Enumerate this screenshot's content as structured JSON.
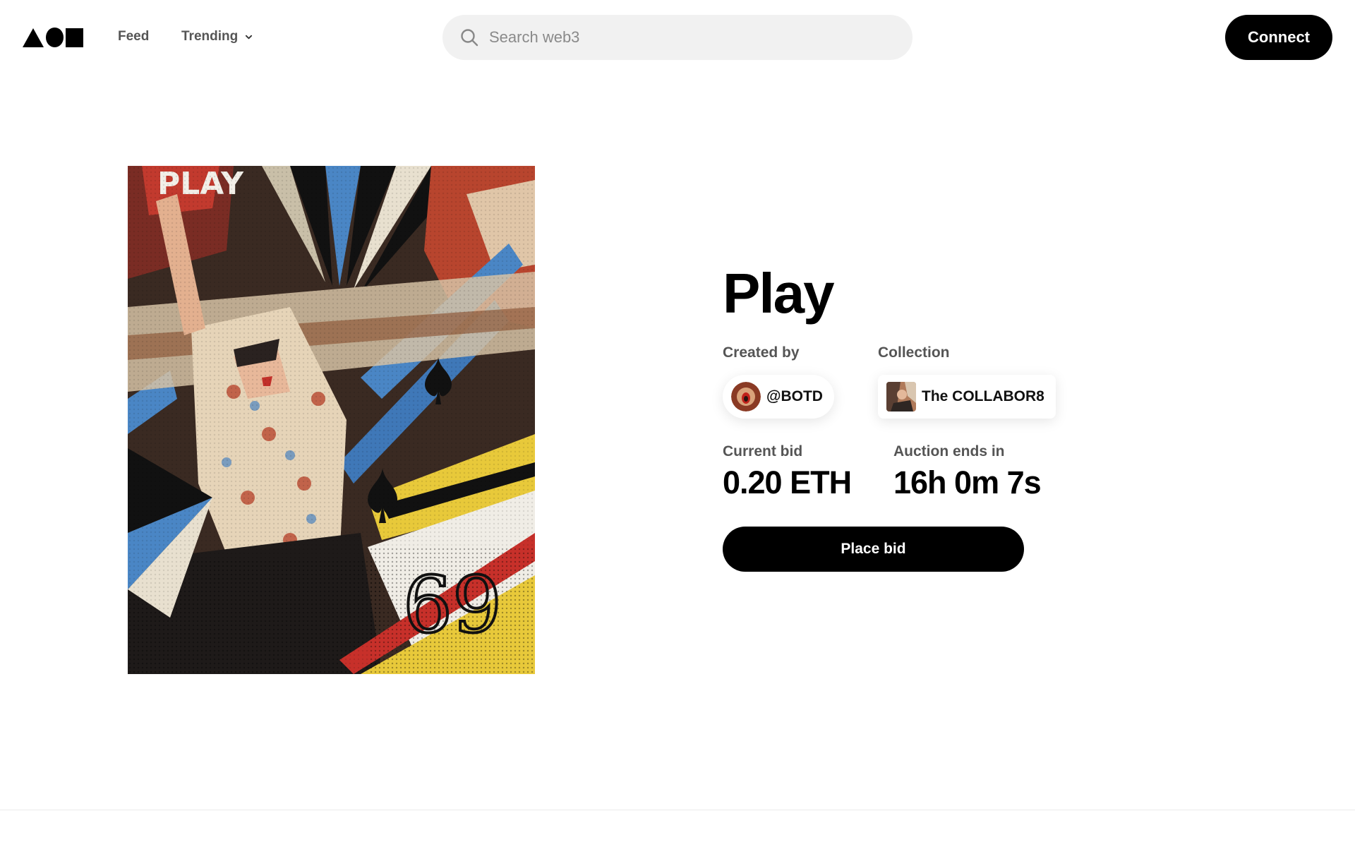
{
  "header": {
    "logo_icon": "shapes-logo-icon",
    "nav": [
      {
        "label": "Feed"
      },
      {
        "label": "Trending",
        "icon": "chevron-down-icon"
      }
    ],
    "search": {
      "placeholder": "Search web3",
      "value": "",
      "icon": "search-icon"
    },
    "connect_label": "Connect"
  },
  "artwork": {
    "visible_text": "PLAY"
  },
  "nft": {
    "title": "Play",
    "created_by": {
      "label": "Created by",
      "handle": "@BOTD"
    },
    "collection": {
      "label": "Collection",
      "name": "The COLLABOR8"
    },
    "current_bid": {
      "label": "Current bid",
      "value": "0.20 ETH"
    },
    "auction": {
      "label": "Auction ends in",
      "value": "16h 0m 7s"
    },
    "place_bid_label": "Place bid"
  },
  "colors": {
    "accent": "#000000",
    "text_muted": "#555555",
    "search_bg": "#f1f1f1"
  }
}
